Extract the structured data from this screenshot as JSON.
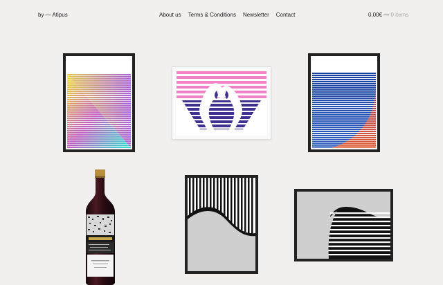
{
  "header": {
    "brand": "by — Atipus",
    "nav": [
      {
        "label": "About us"
      },
      {
        "label": "Terms & Conditions"
      },
      {
        "label": "Newsletter"
      },
      {
        "label": "Contact"
      }
    ],
    "cart": {
      "total": "0,00€",
      "separator": " — ",
      "items": "0 items"
    }
  },
  "products": [
    {
      "name": "print-gradient-triangle",
      "colors": [
        "#f0e030",
        "#b050d0",
        "#30e0d0"
      ]
    },
    {
      "name": "print-flamingos",
      "colors": [
        "#f080c8",
        "#403090"
      ]
    },
    {
      "name": "print-blue-red-curve",
      "colors": [
        "#2040a0",
        "#e05030"
      ]
    },
    {
      "name": "wine-bottle",
      "colors": [
        "#3a1018",
        "#c0a040"
      ]
    },
    {
      "name": "print-stripes-wave",
      "colors": [
        "#111111",
        "#cfcfcf"
      ]
    },
    {
      "name": "print-wave-stripes",
      "colors": [
        "#111111",
        "#cfcfcf"
      ]
    }
  ]
}
